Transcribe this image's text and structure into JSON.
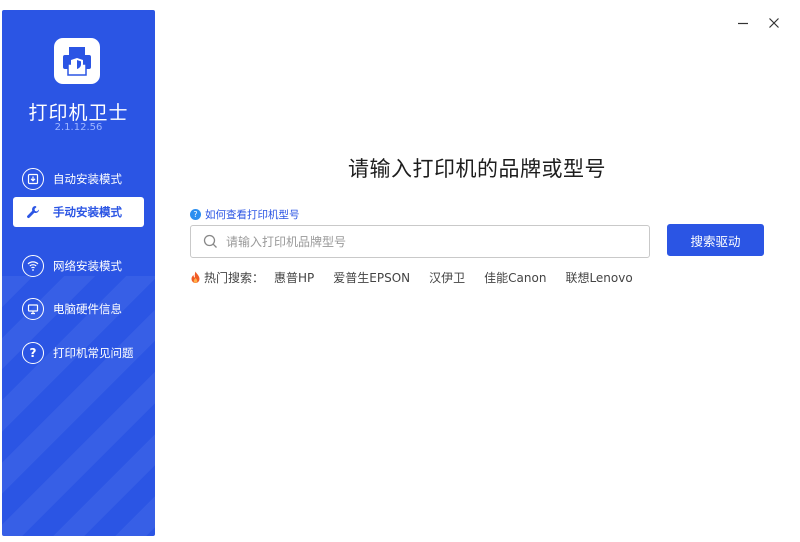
{
  "window": {
    "minimize_icon": "minimize-icon",
    "close_icon": "close-icon"
  },
  "sidebar": {
    "app_name": "打印机卫士",
    "version": "2.1.12.56",
    "accent": "#2b55e4",
    "items": [
      {
        "label": "自动安装模式",
        "icon": "download-icon",
        "active": false
      },
      {
        "label": "手动安装模式",
        "icon": "wrench-icon",
        "active": true
      },
      {
        "label": "网络安装模式",
        "icon": "network-icon",
        "active": false
      },
      {
        "label": "电脑硬件信息",
        "icon": "monitor-icon",
        "active": false
      },
      {
        "label": "打印机常见问题",
        "icon": "question-icon",
        "active": false
      }
    ]
  },
  "main": {
    "headline": "请输入打印机的品牌或型号",
    "help_link": "如何查看打印机型号",
    "search": {
      "value": "",
      "placeholder": "请输入打印机品牌型号"
    },
    "search_button": "搜索驱动",
    "hot_label": "热门搜索：",
    "hot_items": [
      "惠普HP",
      "爱普生EPSON",
      "汉伊卫",
      "佳能Canon",
      "联想Lenovo"
    ]
  }
}
